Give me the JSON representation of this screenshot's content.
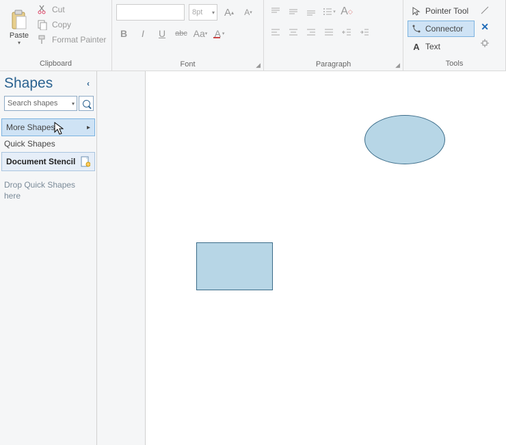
{
  "ribbon": {
    "clipboard": {
      "label": "Clipboard",
      "paste": "Paste",
      "cut": "Cut",
      "copy": "Copy",
      "format_painter": "Format Painter"
    },
    "font": {
      "label": "Font",
      "size": "8pt"
    },
    "paragraph": {
      "label": "Paragraph"
    },
    "tools": {
      "label": "Tools",
      "pointer": "Pointer Tool",
      "connector": "Connector",
      "text": "Text"
    }
  },
  "shapes_pane": {
    "title": "Shapes",
    "search_placeholder": "Search shapes",
    "more_shapes": "More Shapes",
    "quick_shapes": "Quick Shapes",
    "document_stencil": "Document Stencil",
    "drop_hint": "Drop Quick Shapes here"
  }
}
